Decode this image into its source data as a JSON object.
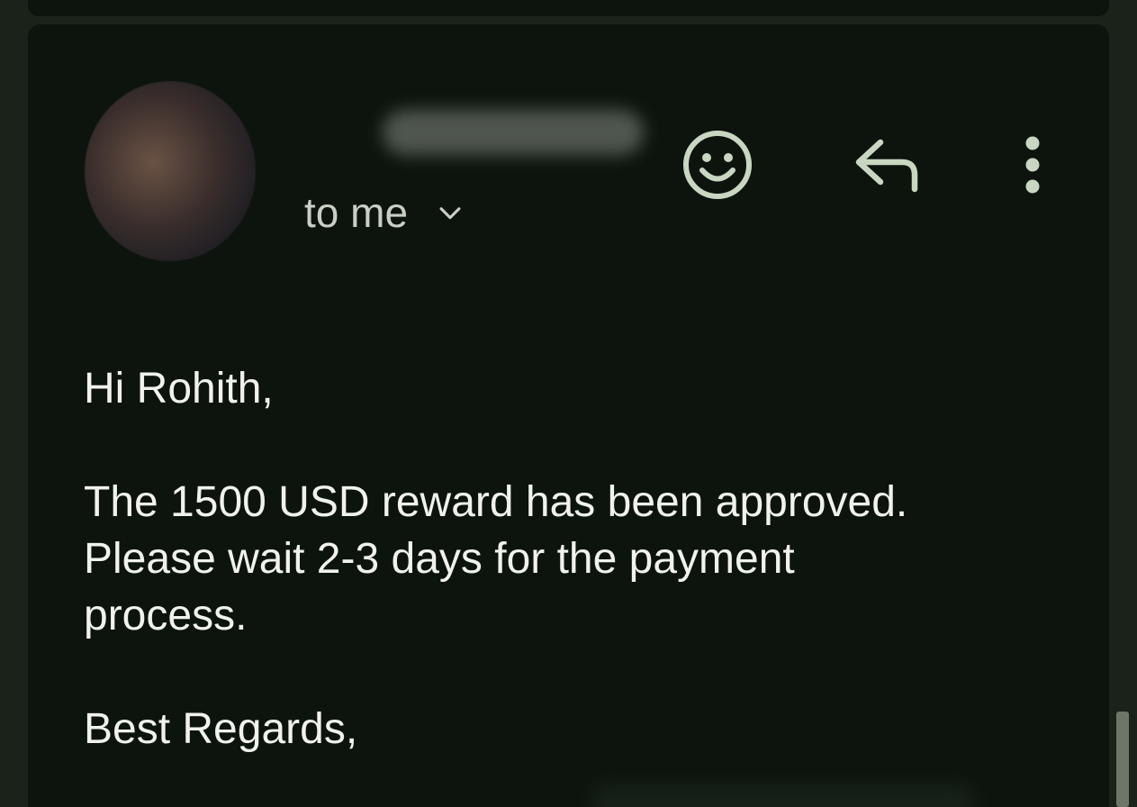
{
  "message": {
    "recipient_text": "to me",
    "greeting": "Hi Rohith,",
    "body_line_1": "The 1500 USD reward has been approved.",
    "body_line_2": "Please wait 2-3 days for the payment",
    "body_line_3": "process.",
    "closing": "Best Regards,"
  },
  "icons": {
    "emoji": "smiley-face-icon",
    "reply": "reply-arrow-icon",
    "more": "more-vertical-icon",
    "expand": "chevron-down-icon"
  },
  "colors": {
    "background": "#1b2219",
    "card": "#0d140e",
    "icon": "#c9d7c2",
    "text": "#f1f2ee"
  }
}
